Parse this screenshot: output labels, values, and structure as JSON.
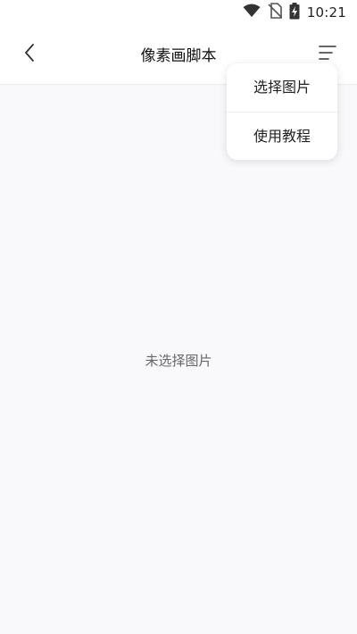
{
  "status_bar": {
    "time": "10:21",
    "icons": [
      "wifi-icon",
      "no-sim-icon",
      "battery-charging-icon"
    ]
  },
  "app_bar": {
    "title": "像素画脚本",
    "back_icon": "chevron-left-icon",
    "menu_icon": "menu-lines-icon"
  },
  "dropdown": {
    "items": [
      {
        "label": "选择图片"
      },
      {
        "label": "使用教程"
      }
    ]
  },
  "main": {
    "empty_message": "未选择图片"
  },
  "colors": {
    "background": "#f9f9fc",
    "bar": "#ffffff",
    "text_primary": "#111111",
    "text_secondary": "#666666"
  }
}
